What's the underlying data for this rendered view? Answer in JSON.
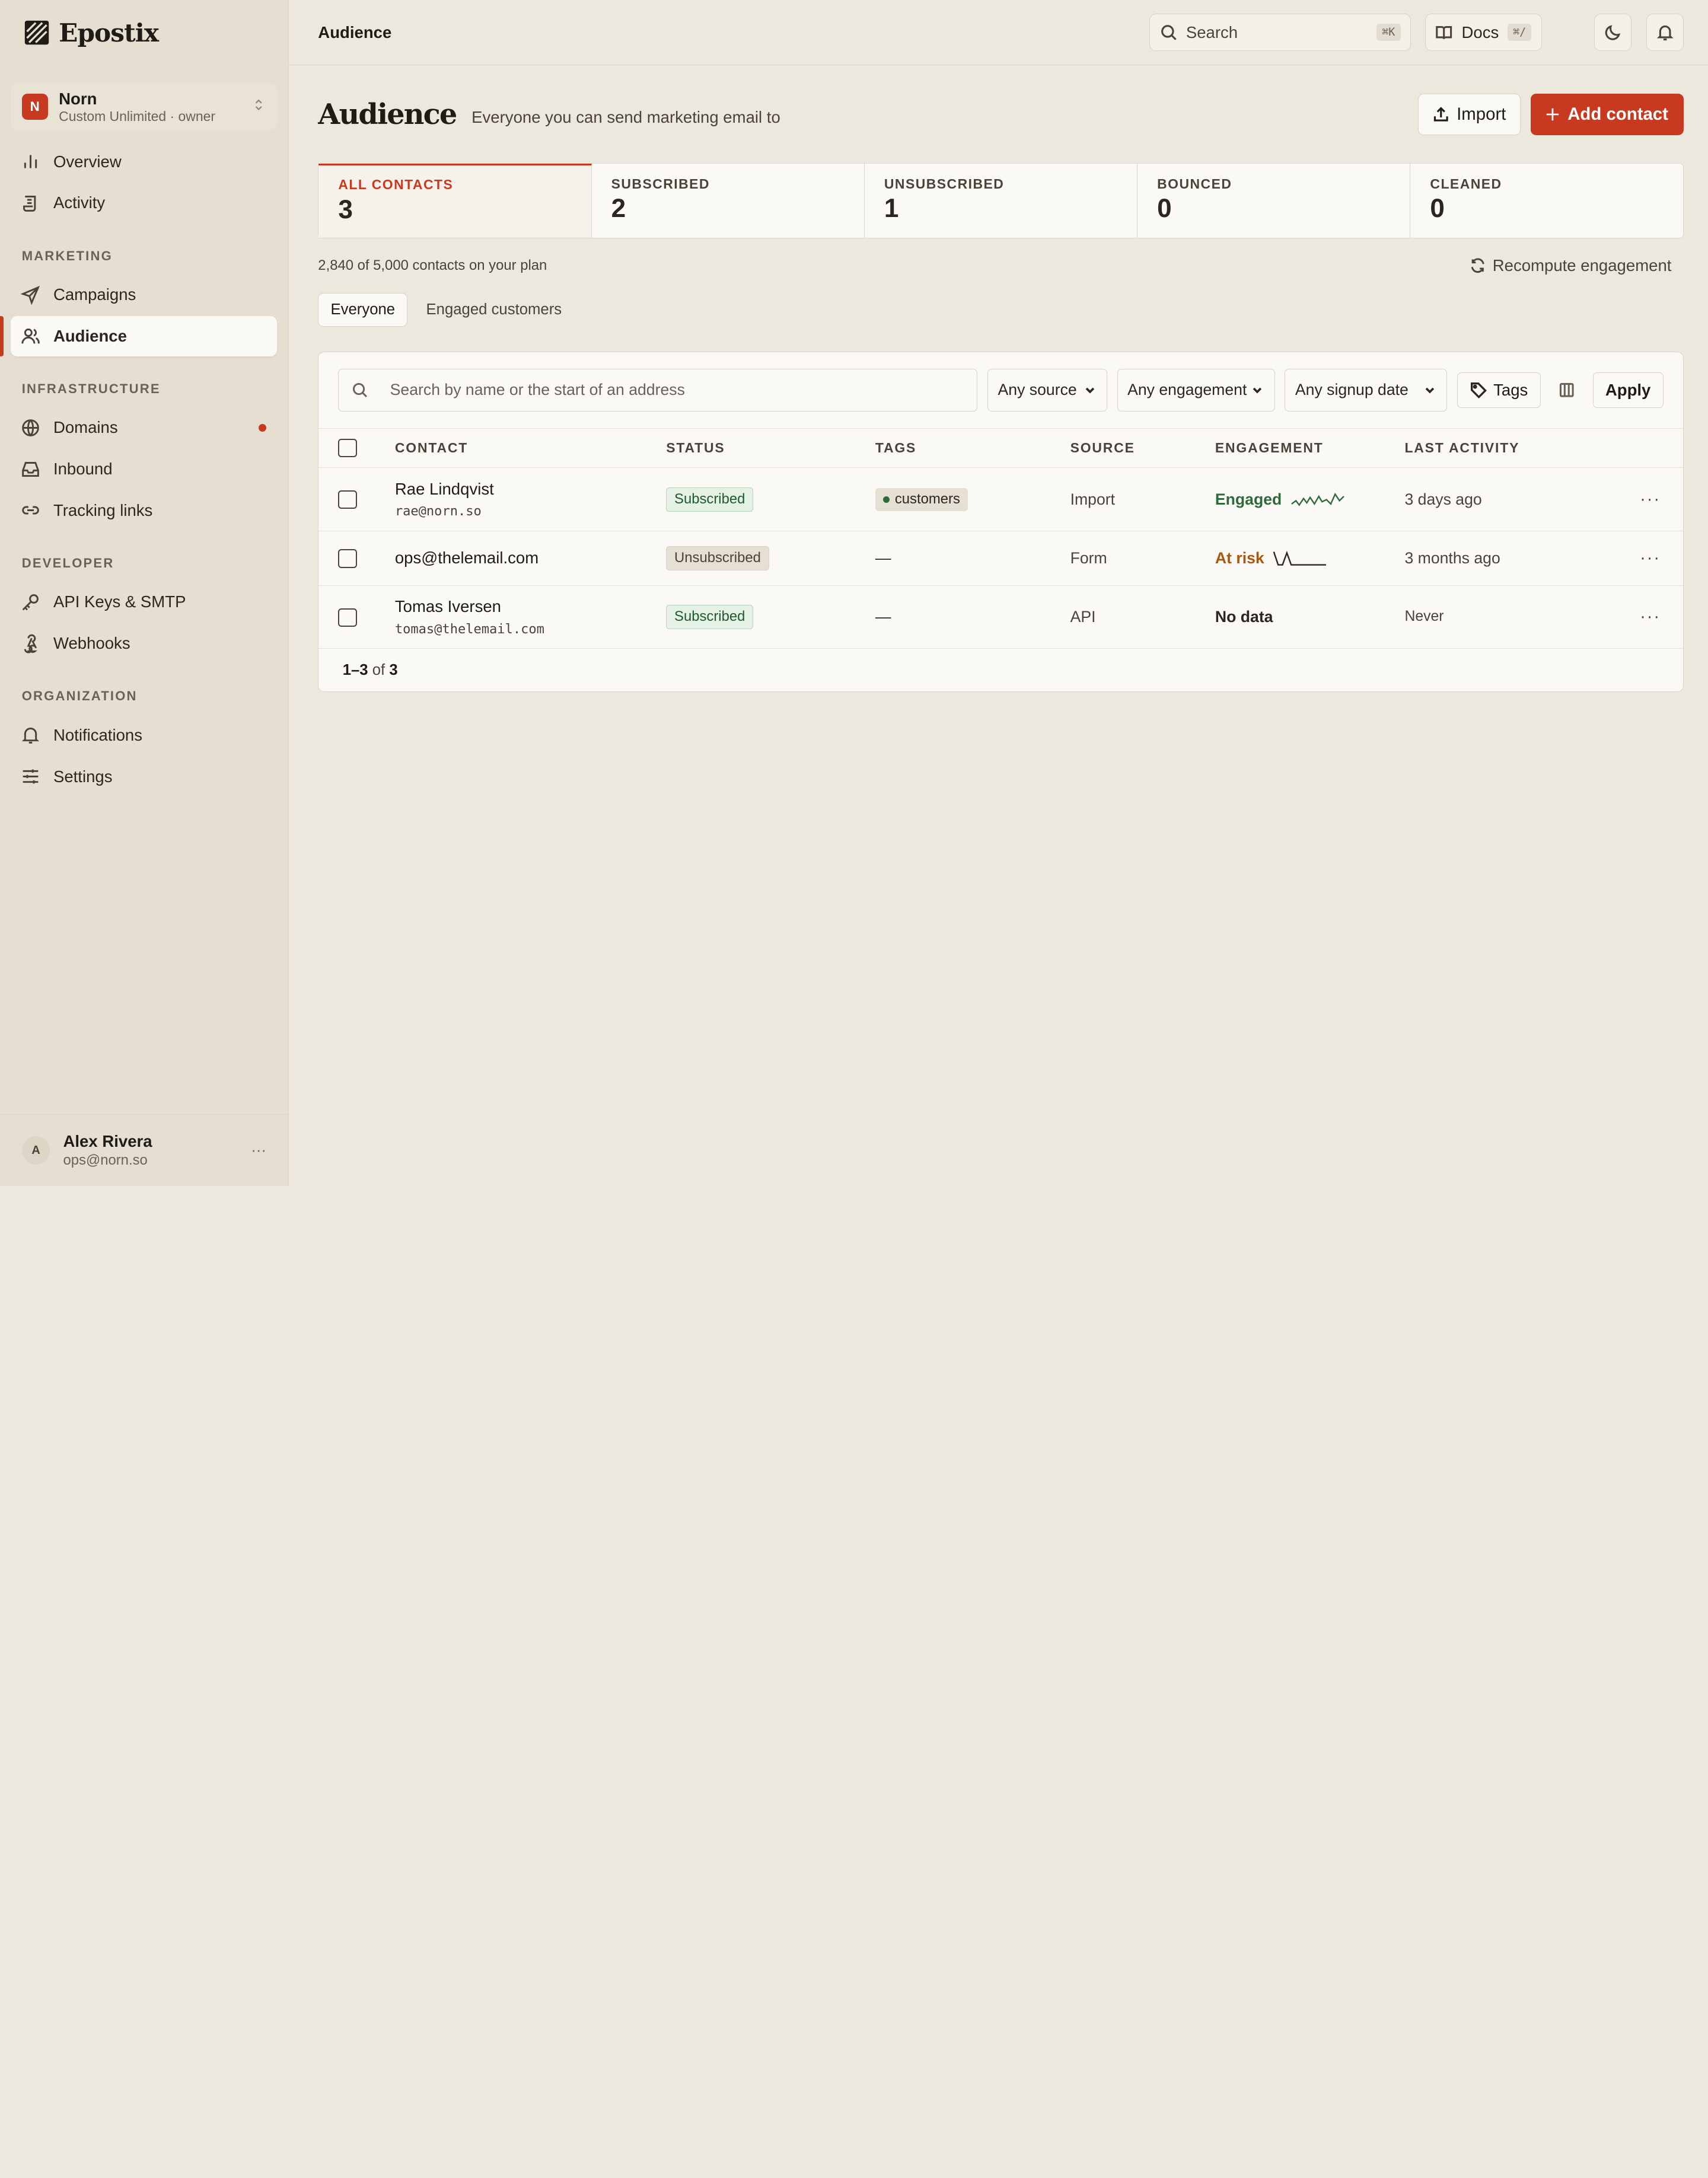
{
  "app": {
    "name": "Epostix"
  },
  "org": {
    "initial": "N",
    "name": "Norn",
    "plan": "Custom Unlimited · owner"
  },
  "nav": {
    "top": [
      {
        "label": "Overview"
      },
      {
        "label": "Activity"
      }
    ],
    "sections": [
      {
        "title": "MARKETING",
        "items": [
          {
            "label": "Campaigns"
          },
          {
            "label": "Audience"
          }
        ]
      },
      {
        "title": "INFRASTRUCTURE",
        "items": [
          {
            "label": "Domains"
          },
          {
            "label": "Inbound"
          },
          {
            "label": "Tracking links"
          }
        ]
      },
      {
        "title": "DEVELOPER",
        "items": [
          {
            "label": "API Keys & SMTP"
          },
          {
            "label": "Webhooks"
          }
        ]
      },
      {
        "title": "ORGANIZATION",
        "items": [
          {
            "label": "Notifications"
          },
          {
            "label": "Settings"
          }
        ]
      }
    ],
    "active": "Audience",
    "alert_item": "Domains"
  },
  "user": {
    "initial": "A",
    "name": "Alex Rivera",
    "email": "ops@norn.so"
  },
  "topbar": {
    "title": "Audience",
    "search_label": "Search",
    "search_kbd": "⌘K",
    "docs_label": "Docs",
    "docs_kbd": "⌘/"
  },
  "page": {
    "title": "Audience",
    "subtitle": "Everyone you can send marketing email to",
    "import_label": "Import",
    "add_label": "Add contact"
  },
  "stats": [
    {
      "label": "ALL CONTACTS",
      "value": "3"
    },
    {
      "label": "SUBSCRIBED",
      "value": "2"
    },
    {
      "label": "UNSUBSCRIBED",
      "value": "1"
    },
    {
      "label": "BOUNCED",
      "value": "0"
    },
    {
      "label": "CLEANED",
      "value": "0"
    }
  ],
  "plan_usage": "2,840 of 5,000 contacts on your plan",
  "recompute_label": "Recompute engagement",
  "segments": [
    "Everyone",
    "Engaged customers"
  ],
  "filters": {
    "search_placeholder": "Search by name or the start of an address",
    "source": "Any source",
    "engagement": "Any engagement",
    "signup": "Any signup date",
    "tags": "Tags",
    "apply": "Apply"
  },
  "table": {
    "columns": [
      "CONTACT",
      "STATUS",
      "TAGS",
      "SOURCE",
      "ENGAGEMENT",
      "LAST ACTIVITY"
    ],
    "rows": [
      {
        "name": "Rae Lindqvist",
        "email": "rae@norn.so",
        "status": "Subscribed",
        "tag": "customers",
        "source": "Import",
        "engagement": "Engaged",
        "last_activity": "3 days ago"
      },
      {
        "name": "ops@thelemail.com",
        "email": "",
        "status": "Unsubscribed",
        "tag": "—",
        "source": "Form",
        "engagement": "At risk",
        "last_activity": "3 months ago"
      },
      {
        "name": "Tomas Iversen",
        "email": "tomas@thelemail.com",
        "status": "Subscribed",
        "tag": "—",
        "source": "API",
        "engagement": "No data",
        "last_activity": "Never"
      }
    ]
  },
  "pagination": {
    "range": "1–3",
    "of_label": "of",
    "total": "3"
  },
  "colors": {
    "accent": "#c73a20",
    "engaged": "#2f6a3d",
    "at_risk": "#a9580c",
    "background": "#ede8de",
    "sidebar": "#e6dfd1"
  }
}
